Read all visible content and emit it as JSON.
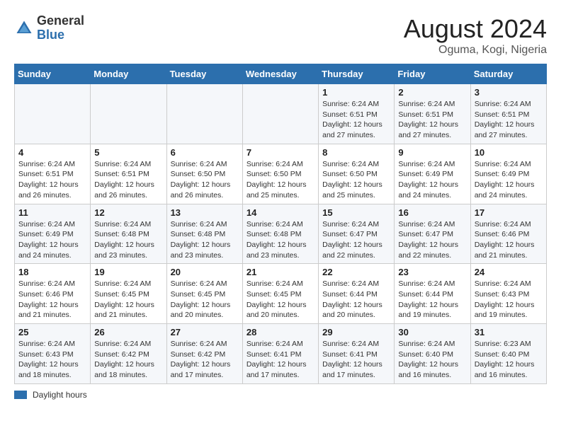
{
  "header": {
    "logo_general": "General",
    "logo_blue": "Blue",
    "month_year": "August 2024",
    "location": "Oguma, Kogi, Nigeria"
  },
  "days_of_week": [
    "Sunday",
    "Monday",
    "Tuesday",
    "Wednesday",
    "Thursday",
    "Friday",
    "Saturday"
  ],
  "weeks": [
    [
      {
        "day": "",
        "info": ""
      },
      {
        "day": "",
        "info": ""
      },
      {
        "day": "",
        "info": ""
      },
      {
        "day": "",
        "info": ""
      },
      {
        "day": "1",
        "info": "Sunrise: 6:24 AM\nSunset: 6:51 PM\nDaylight: 12 hours\nand 27 minutes."
      },
      {
        "day": "2",
        "info": "Sunrise: 6:24 AM\nSunset: 6:51 PM\nDaylight: 12 hours\nand 27 minutes."
      },
      {
        "day": "3",
        "info": "Sunrise: 6:24 AM\nSunset: 6:51 PM\nDaylight: 12 hours\nand 27 minutes."
      }
    ],
    [
      {
        "day": "4",
        "info": "Sunrise: 6:24 AM\nSunset: 6:51 PM\nDaylight: 12 hours\nand 26 minutes."
      },
      {
        "day": "5",
        "info": "Sunrise: 6:24 AM\nSunset: 6:51 PM\nDaylight: 12 hours\nand 26 minutes."
      },
      {
        "day": "6",
        "info": "Sunrise: 6:24 AM\nSunset: 6:50 PM\nDaylight: 12 hours\nand 26 minutes."
      },
      {
        "day": "7",
        "info": "Sunrise: 6:24 AM\nSunset: 6:50 PM\nDaylight: 12 hours\nand 25 minutes."
      },
      {
        "day": "8",
        "info": "Sunrise: 6:24 AM\nSunset: 6:50 PM\nDaylight: 12 hours\nand 25 minutes."
      },
      {
        "day": "9",
        "info": "Sunrise: 6:24 AM\nSunset: 6:49 PM\nDaylight: 12 hours\nand 24 minutes."
      },
      {
        "day": "10",
        "info": "Sunrise: 6:24 AM\nSunset: 6:49 PM\nDaylight: 12 hours\nand 24 minutes."
      }
    ],
    [
      {
        "day": "11",
        "info": "Sunrise: 6:24 AM\nSunset: 6:49 PM\nDaylight: 12 hours\nand 24 minutes."
      },
      {
        "day": "12",
        "info": "Sunrise: 6:24 AM\nSunset: 6:48 PM\nDaylight: 12 hours\nand 23 minutes."
      },
      {
        "day": "13",
        "info": "Sunrise: 6:24 AM\nSunset: 6:48 PM\nDaylight: 12 hours\nand 23 minutes."
      },
      {
        "day": "14",
        "info": "Sunrise: 6:24 AM\nSunset: 6:48 PM\nDaylight: 12 hours\nand 23 minutes."
      },
      {
        "day": "15",
        "info": "Sunrise: 6:24 AM\nSunset: 6:47 PM\nDaylight: 12 hours\nand 22 minutes."
      },
      {
        "day": "16",
        "info": "Sunrise: 6:24 AM\nSunset: 6:47 PM\nDaylight: 12 hours\nand 22 minutes."
      },
      {
        "day": "17",
        "info": "Sunrise: 6:24 AM\nSunset: 6:46 PM\nDaylight: 12 hours\nand 21 minutes."
      }
    ],
    [
      {
        "day": "18",
        "info": "Sunrise: 6:24 AM\nSunset: 6:46 PM\nDaylight: 12 hours\nand 21 minutes."
      },
      {
        "day": "19",
        "info": "Sunrise: 6:24 AM\nSunset: 6:45 PM\nDaylight: 12 hours\nand 21 minutes."
      },
      {
        "day": "20",
        "info": "Sunrise: 6:24 AM\nSunset: 6:45 PM\nDaylight: 12 hours\nand 20 minutes."
      },
      {
        "day": "21",
        "info": "Sunrise: 6:24 AM\nSunset: 6:45 PM\nDaylight: 12 hours\nand 20 minutes."
      },
      {
        "day": "22",
        "info": "Sunrise: 6:24 AM\nSunset: 6:44 PM\nDaylight: 12 hours\nand 20 minutes."
      },
      {
        "day": "23",
        "info": "Sunrise: 6:24 AM\nSunset: 6:44 PM\nDaylight: 12 hours\nand 19 minutes."
      },
      {
        "day": "24",
        "info": "Sunrise: 6:24 AM\nSunset: 6:43 PM\nDaylight: 12 hours\nand 19 minutes."
      }
    ],
    [
      {
        "day": "25",
        "info": "Sunrise: 6:24 AM\nSunset: 6:43 PM\nDaylight: 12 hours\nand 18 minutes."
      },
      {
        "day": "26",
        "info": "Sunrise: 6:24 AM\nSunset: 6:42 PM\nDaylight: 12 hours\nand 18 minutes."
      },
      {
        "day": "27",
        "info": "Sunrise: 6:24 AM\nSunset: 6:42 PM\nDaylight: 12 hours\nand 17 minutes."
      },
      {
        "day": "28",
        "info": "Sunrise: 6:24 AM\nSunset: 6:41 PM\nDaylight: 12 hours\nand 17 minutes."
      },
      {
        "day": "29",
        "info": "Sunrise: 6:24 AM\nSunset: 6:41 PM\nDaylight: 12 hours\nand 17 minutes."
      },
      {
        "day": "30",
        "info": "Sunrise: 6:24 AM\nSunset: 6:40 PM\nDaylight: 12 hours\nand 16 minutes."
      },
      {
        "day": "31",
        "info": "Sunrise: 6:23 AM\nSunset: 6:40 PM\nDaylight: 12 hours\nand 16 minutes."
      }
    ]
  ],
  "legend": {
    "daylight_label": "Daylight hours"
  }
}
